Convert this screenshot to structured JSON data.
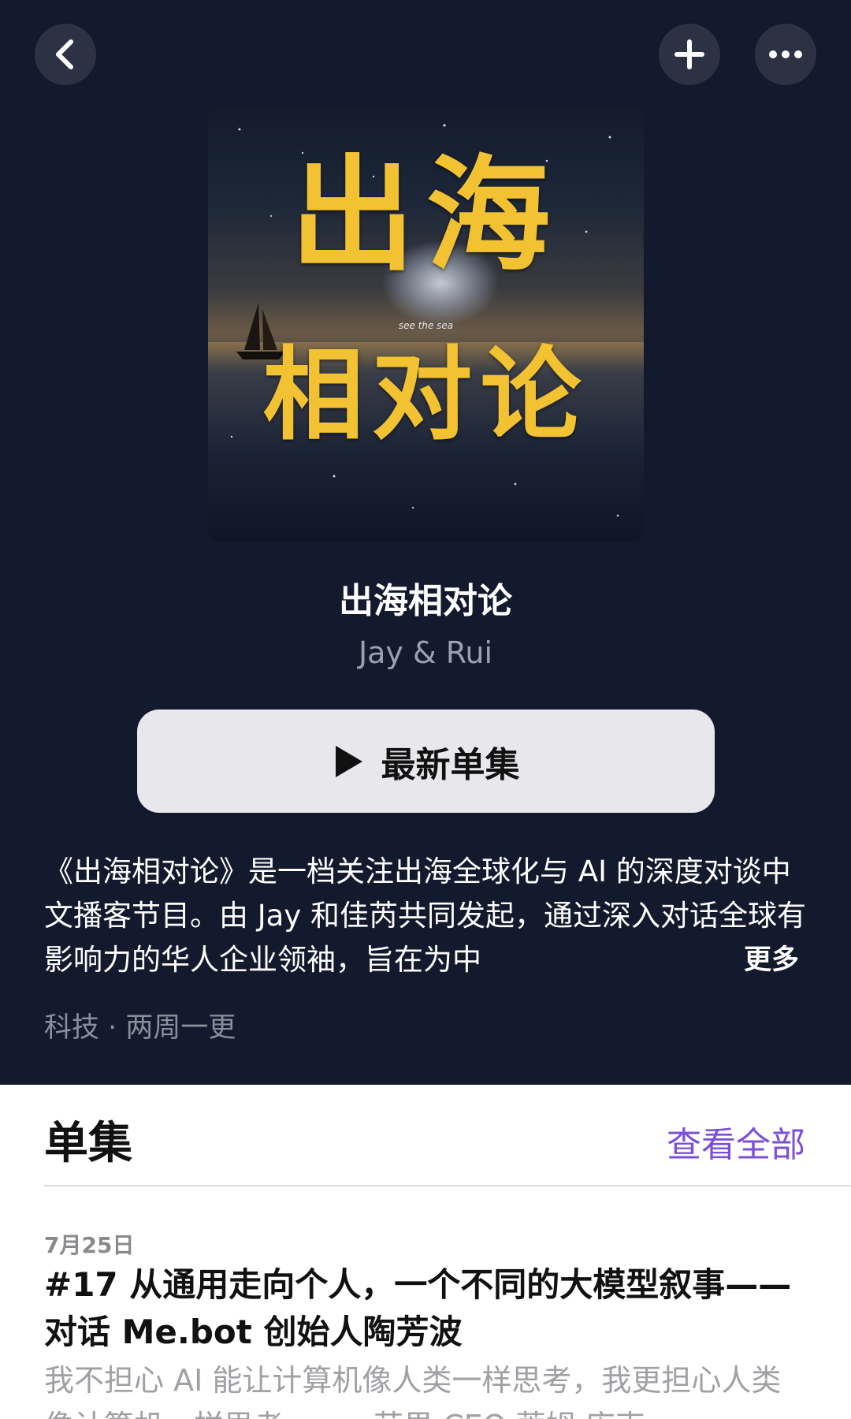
{
  "nav": {
    "back_icon": "chevron-left-icon",
    "add_icon": "plus-icon",
    "more_icon": "ellipsis-icon"
  },
  "cover": {
    "line1": "出海",
    "line2": "相对论",
    "tagline": "see the sea"
  },
  "podcast": {
    "title": "出海相对论",
    "author": "Jay & Rui",
    "play_label": "最新单集",
    "description": "《出海相对论》是一档关注出海全球化与 AI 的深度对谈中文播客节目。由 Jay 和佳芮共同发起，通过深入对话全球有影响力的华人企业领袖，旨在为中",
    "more_label": "更多",
    "meta": "科技 · 两周一更"
  },
  "episodes": {
    "header": "单集",
    "see_all": "查看全部",
    "items": [
      {
        "date": "7月25日",
        "title": "#17 从通用走向个人，一个不同的大模型叙事——对话 Me.bot 创始人陶芳波",
        "summary": "我不担心 AI 能让计算机像人类一样思考，我更担心人类像计算机一样思考。——苹果 CEO 蒂姆·库克"
      }
    ]
  },
  "colors": {
    "hero_bg": "#131a2d",
    "accent": "#7b4fd6",
    "cover_title": "#f2c232"
  }
}
